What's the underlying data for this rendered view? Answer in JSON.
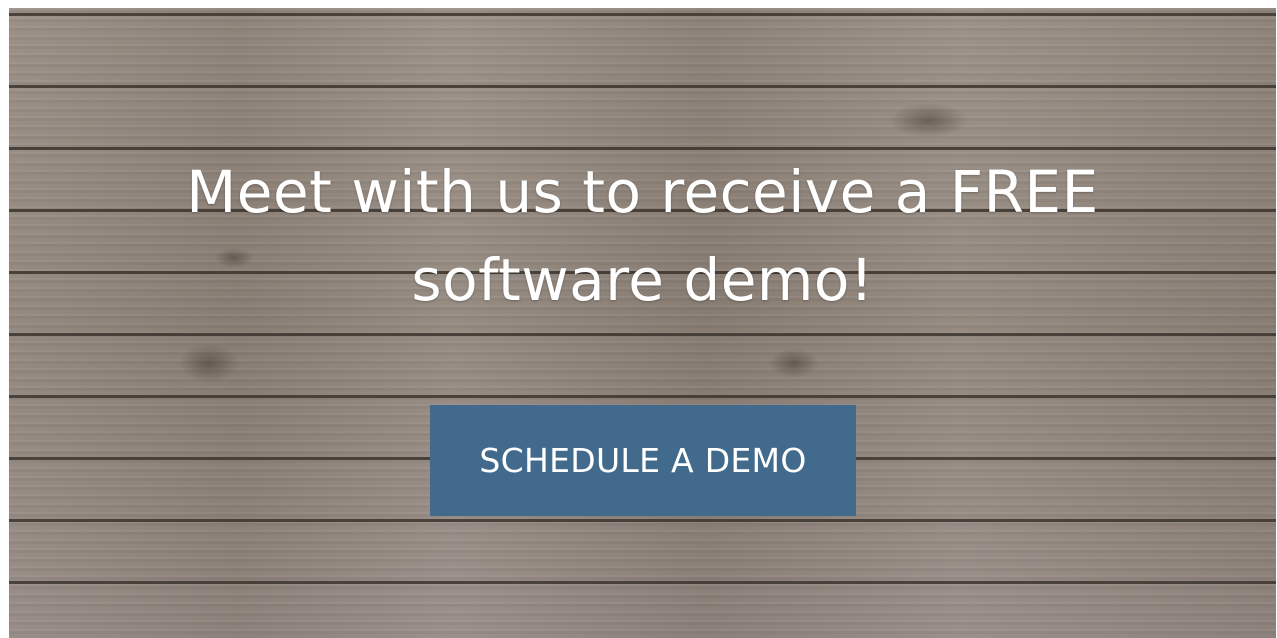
{
  "hero": {
    "headline_line1": "Meet with us to receive a FREE",
    "headline_line2": "software demo!",
    "background": "wood-plank-texture"
  },
  "cta": {
    "label": "SCHEDULE A DEMO",
    "color": "#416a8d"
  }
}
